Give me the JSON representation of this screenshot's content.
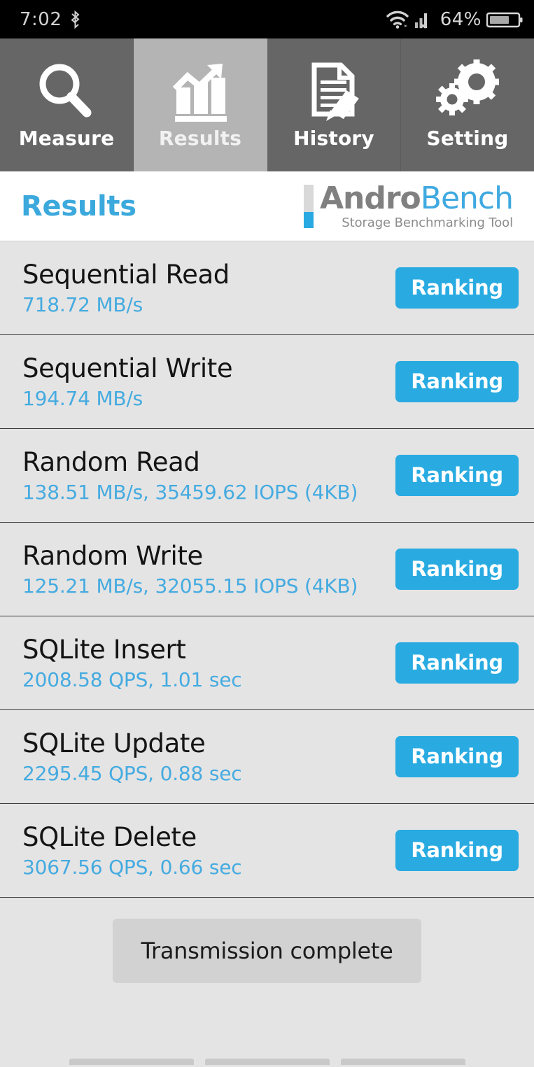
{
  "status_bar": {
    "clock": "7:02",
    "bluetooth_icon": "bluetooth-icon",
    "wifi_icon": "wifi-icon",
    "signal_icon": "cellular-signal-no-sim-icon",
    "battery_percent": "64%",
    "battery_icon": "battery-icon"
  },
  "tabs": [
    {
      "label": "Measure",
      "icon": "magnifier-icon",
      "selected": false
    },
    {
      "label": "Results",
      "icon": "bar-chart-arrow-icon",
      "selected": true
    },
    {
      "label": "History",
      "icon": "document-pencil-icon",
      "selected": false
    },
    {
      "label": "Setting",
      "icon": "gears-icon",
      "selected": false
    }
  ],
  "header": {
    "title": "Results",
    "logo": {
      "word_primary": "Andro",
      "word_secondary": "Bench",
      "tagline": "Storage Benchmarking Tool"
    }
  },
  "results": [
    {
      "name": "Sequential Read",
      "value": "718.72 MB/s",
      "action": "Ranking"
    },
    {
      "name": "Sequential Write",
      "value": "194.74 MB/s",
      "action": "Ranking"
    },
    {
      "name": "Random Read",
      "value": "138.51 MB/s, 35459.62 IOPS (4KB)",
      "action": "Ranking"
    },
    {
      "name": "Random Write",
      "value": "125.21 MB/s, 32055.15 IOPS (4KB)",
      "action": "Ranking"
    },
    {
      "name": "SQLite Insert",
      "value": "2008.58 QPS, 1.01 sec",
      "action": "Ranking"
    },
    {
      "name": "SQLite Update",
      "value": "2295.45 QPS, 0.88 sec",
      "action": "Ranking"
    },
    {
      "name": "SQLite Delete",
      "value": "3067.56 QPS, 0.66 sec",
      "action": "Ranking"
    }
  ],
  "footer": {
    "transmission_label": "Transmission complete"
  },
  "colors": {
    "accent_blue": "#29abe2",
    "title_blue": "#3ca9dd",
    "value_blue": "#45abe0",
    "logo_gray": "#808080",
    "tab_bg": "#666666",
    "tab_selected_bg": "#b4b4b4",
    "list_bg": "#e5e4e4",
    "status_bar_bg": "#000000",
    "transmission_bg": "#d2d2d2"
  }
}
